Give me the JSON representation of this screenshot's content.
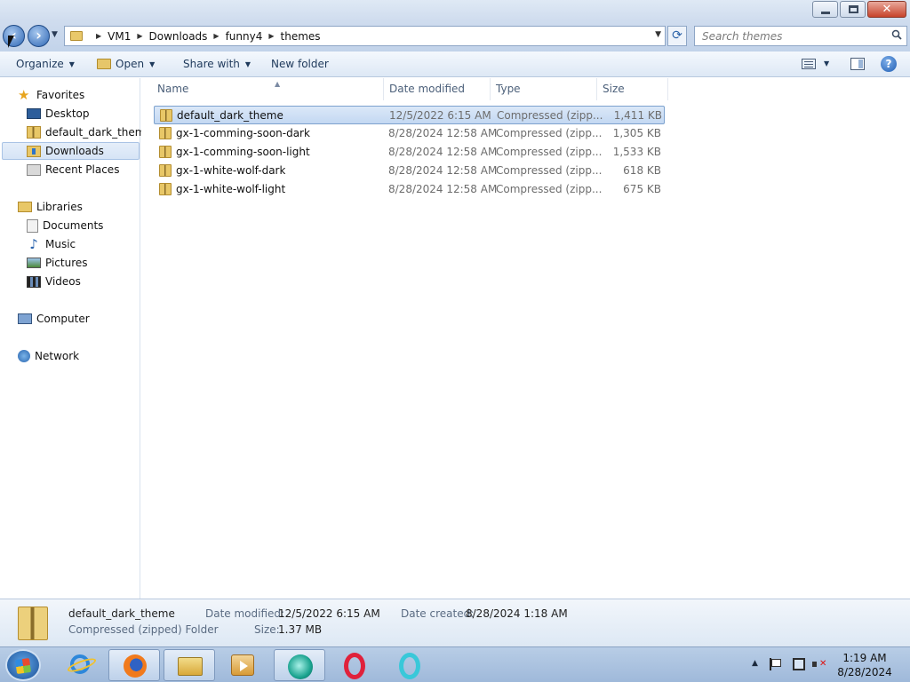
{
  "window": {
    "controls": {
      "minimize": "minimize",
      "maximize": "maximize",
      "close": "close"
    }
  },
  "address_bar": {
    "breadcrumbs": [
      "VM1",
      "Downloads",
      "funny4",
      "themes"
    ]
  },
  "search": {
    "placeholder": "Search themes"
  },
  "toolbar": {
    "organize": "Organize",
    "open": "Open",
    "share_with": "Share with",
    "new_folder": "New folder"
  },
  "nav_pane": {
    "favorites": "Favorites",
    "favorite_items": [
      "Desktop",
      "default_dark_theme",
      "Downloads",
      "Recent Places"
    ],
    "libraries": "Libraries",
    "library_items": [
      "Documents",
      "Music",
      "Pictures",
      "Videos"
    ],
    "computer": "Computer",
    "network": "Network"
  },
  "columns": {
    "name": "Name",
    "date_modified": "Date modified",
    "type": "Type",
    "size": "Size"
  },
  "files": [
    {
      "name": "default_dark_theme",
      "date": "12/5/2022 6:15 AM",
      "type": "Compressed (zipp...",
      "size": "1,411 KB"
    },
    {
      "name": "gx-1-comming-soon-dark",
      "date": "8/28/2024 12:58 AM",
      "type": "Compressed (zipp...",
      "size": "1,305 KB"
    },
    {
      "name": "gx-1-comming-soon-light",
      "date": "8/28/2024 12:58 AM",
      "type": "Compressed (zipp...",
      "size": "1,533 KB"
    },
    {
      "name": "gx-1-white-wolf-dark",
      "date": "8/28/2024 12:58 AM",
      "type": "Compressed (zipp...",
      "size": "618 KB"
    },
    {
      "name": "gx-1-white-wolf-light",
      "date": "8/28/2024 12:58 AM",
      "type": "Compressed (zipp...",
      "size": "675 KB"
    }
  ],
  "details": {
    "name": "default_dark_theme",
    "type": "Compressed (zipped) Folder",
    "date_modified_label": "Date modified:",
    "date_modified": "12/5/2022 6:15 AM",
    "date_created_label": "Date created:",
    "date_created": "8/28/2024 1:18 AM",
    "size_label": "Size:",
    "size": "1.37 MB"
  },
  "taskbar": {
    "apps": [
      "internet-explorer-icon",
      "firefox-icon",
      "windows-explorer-icon",
      "media-player-icon",
      "app-icon",
      "opera-icon",
      "opera-gx-icon"
    ]
  },
  "clock": {
    "time": "1:19 AM",
    "date": "8/28/2024"
  }
}
